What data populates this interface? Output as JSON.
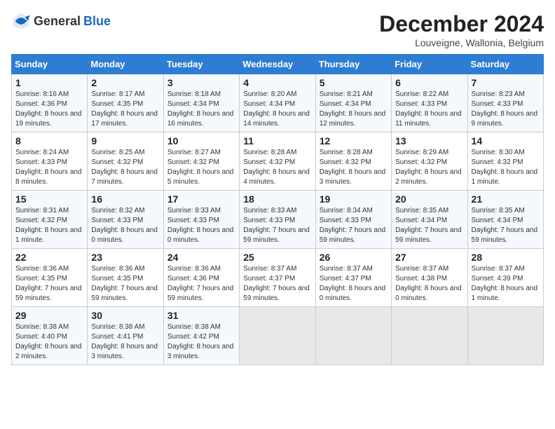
{
  "logo": {
    "general": "General",
    "blue": "Blue"
  },
  "header": {
    "month": "December 2024",
    "location": "Louveigne, Wallonia, Belgium"
  },
  "columns": [
    "Sunday",
    "Monday",
    "Tuesday",
    "Wednesday",
    "Thursday",
    "Friday",
    "Saturday"
  ],
  "weeks": [
    [
      {
        "day": "1",
        "info": "Sunrise: 8:16 AM\nSunset: 4:36 PM\nDaylight: 8 hours and 19 minutes."
      },
      {
        "day": "2",
        "info": "Sunrise: 8:17 AM\nSunset: 4:35 PM\nDaylight: 8 hours and 17 minutes."
      },
      {
        "day": "3",
        "info": "Sunrise: 8:18 AM\nSunset: 4:34 PM\nDaylight: 8 hours and 16 minutes."
      },
      {
        "day": "4",
        "info": "Sunrise: 8:20 AM\nSunset: 4:34 PM\nDaylight: 8 hours and 14 minutes."
      },
      {
        "day": "5",
        "info": "Sunrise: 8:21 AM\nSunset: 4:34 PM\nDaylight: 8 hours and 12 minutes."
      },
      {
        "day": "6",
        "info": "Sunrise: 8:22 AM\nSunset: 4:33 PM\nDaylight: 8 hours and 11 minutes."
      },
      {
        "day": "7",
        "info": "Sunrise: 8:23 AM\nSunset: 4:33 PM\nDaylight: 8 hours and 9 minutes."
      }
    ],
    [
      {
        "day": "8",
        "info": "Sunrise: 8:24 AM\nSunset: 4:33 PM\nDaylight: 8 hours and 8 minutes."
      },
      {
        "day": "9",
        "info": "Sunrise: 8:25 AM\nSunset: 4:32 PM\nDaylight: 8 hours and 7 minutes."
      },
      {
        "day": "10",
        "info": "Sunrise: 8:27 AM\nSunset: 4:32 PM\nDaylight: 8 hours and 5 minutes."
      },
      {
        "day": "11",
        "info": "Sunrise: 8:28 AM\nSunset: 4:32 PM\nDaylight: 8 hours and 4 minutes."
      },
      {
        "day": "12",
        "info": "Sunrise: 8:28 AM\nSunset: 4:32 PM\nDaylight: 8 hours and 3 minutes."
      },
      {
        "day": "13",
        "info": "Sunrise: 8:29 AM\nSunset: 4:32 PM\nDaylight: 8 hours and 2 minutes."
      },
      {
        "day": "14",
        "info": "Sunrise: 8:30 AM\nSunset: 4:32 PM\nDaylight: 8 hours and 1 minute."
      }
    ],
    [
      {
        "day": "15",
        "info": "Sunrise: 8:31 AM\nSunset: 4:32 PM\nDaylight: 8 hours and 1 minute."
      },
      {
        "day": "16",
        "info": "Sunrise: 8:32 AM\nSunset: 4:33 PM\nDaylight: 8 hours and 0 minutes."
      },
      {
        "day": "17",
        "info": "Sunrise: 8:33 AM\nSunset: 4:33 PM\nDaylight: 8 hours and 0 minutes."
      },
      {
        "day": "18",
        "info": "Sunrise: 8:33 AM\nSunset: 4:33 PM\nDaylight: 7 hours and 59 minutes."
      },
      {
        "day": "19",
        "info": "Sunrise: 8:34 AM\nSunset: 4:33 PM\nDaylight: 7 hours and 59 minutes."
      },
      {
        "day": "20",
        "info": "Sunrise: 8:35 AM\nSunset: 4:34 PM\nDaylight: 7 hours and 59 minutes."
      },
      {
        "day": "21",
        "info": "Sunrise: 8:35 AM\nSunset: 4:34 PM\nDaylight: 7 hours and 59 minutes."
      }
    ],
    [
      {
        "day": "22",
        "info": "Sunrise: 8:36 AM\nSunset: 4:35 PM\nDaylight: 7 hours and 59 minutes."
      },
      {
        "day": "23",
        "info": "Sunrise: 8:36 AM\nSunset: 4:35 PM\nDaylight: 7 hours and 59 minutes."
      },
      {
        "day": "24",
        "info": "Sunrise: 8:36 AM\nSunset: 4:36 PM\nDaylight: 7 hours and 59 minutes."
      },
      {
        "day": "25",
        "info": "Sunrise: 8:37 AM\nSunset: 4:37 PM\nDaylight: 7 hours and 59 minutes."
      },
      {
        "day": "26",
        "info": "Sunrise: 8:37 AM\nSunset: 4:37 PM\nDaylight: 8 hours and 0 minutes."
      },
      {
        "day": "27",
        "info": "Sunrise: 8:37 AM\nSunset: 4:38 PM\nDaylight: 8 hours and 0 minutes."
      },
      {
        "day": "28",
        "info": "Sunrise: 8:37 AM\nSunset: 4:39 PM\nDaylight: 8 hours and 1 minute."
      }
    ],
    [
      {
        "day": "29",
        "info": "Sunrise: 8:38 AM\nSunset: 4:40 PM\nDaylight: 8 hours and 2 minutes."
      },
      {
        "day": "30",
        "info": "Sunrise: 8:38 AM\nSunset: 4:41 PM\nDaylight: 8 hours and 3 minutes."
      },
      {
        "day": "31",
        "info": "Sunrise: 8:38 AM\nSunset: 4:42 PM\nDaylight: 8 hours and 3 minutes."
      },
      null,
      null,
      null,
      null
    ]
  ]
}
